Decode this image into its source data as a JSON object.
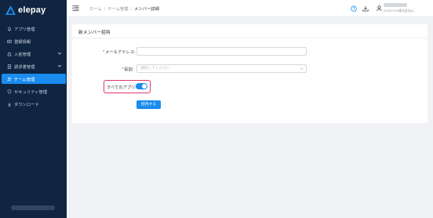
{
  "app": {
    "logo_text": "elepay"
  },
  "sidebar": {
    "items": [
      {
        "label": "アプリ管理",
        "icon": "rocket-icon",
        "active": false,
        "has_chevron": false
      },
      {
        "label": "登録情報",
        "icon": "id-card-icon",
        "active": false,
        "has_chevron": false
      },
      {
        "label": "入金管理",
        "icon": "money-bag-icon",
        "active": false,
        "has_chevron": true
      },
      {
        "label": "請求書管理",
        "icon": "invoice-icon",
        "active": false,
        "has_chevron": true
      },
      {
        "label": "チーム管理",
        "icon": "team-icon",
        "active": true,
        "has_chevron": false
      },
      {
        "label": "セキュリティ管理",
        "icon": "shield-icon",
        "active": false,
        "has_chevron": false
      },
      {
        "label": "ダウンロード",
        "icon": "download-icon",
        "active": false,
        "has_chevron": false
      }
    ]
  },
  "header": {
    "breadcrumb": [
      "ホーム",
      "チーム管理",
      "メンバー詳細"
    ],
    "company": "ELESTYLE株式会社(E..."
  },
  "form": {
    "title": "新メンバー招待",
    "email_label": "メールアドレス:",
    "email_value": "",
    "role_label": "役割:",
    "role_placeholder": "選択してください",
    "all_apps_label": "すべてのアプリ:",
    "all_apps_enabled": true,
    "submit_label": "招待する"
  },
  "colors": {
    "sidebar_bg": "#0f2541",
    "accent": "#1a8cf0",
    "highlight": "#e0356f",
    "required": "#e0392b"
  }
}
